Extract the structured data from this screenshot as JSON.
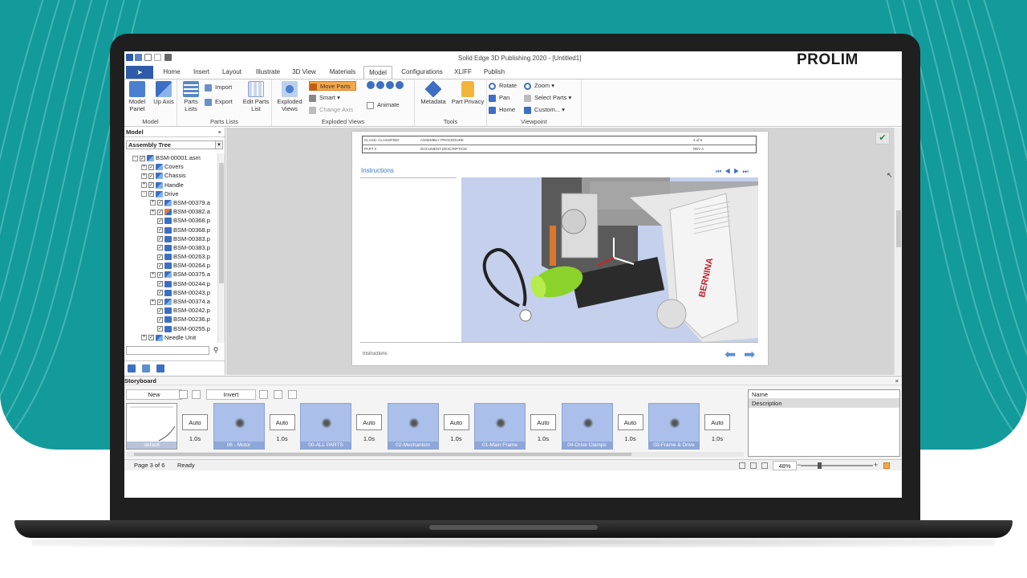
{
  "brand": "PROLIM",
  "app": {
    "title": "Solid Edge 3D Publishing  2020 - [Untitled1]"
  },
  "tabs": [
    "Home",
    "Insert",
    "Layout",
    "Illustrate",
    "3D View",
    "Materials",
    "Model",
    "Configurations",
    "XLIFF",
    "Publish"
  ],
  "ribbon": {
    "model": {
      "group": "Model",
      "model_panel": "Model Panel",
      "up_axis": "Up Axis"
    },
    "parts_lists": {
      "group": "Parts Lists",
      "parts_lists": "Parts Lists",
      "import": "Import",
      "export": "Export",
      "edit_parts_list": "Edit Parts List"
    },
    "exploded": {
      "group": "Exploded Views",
      "exploded_views": "Exploded Views",
      "move_parts": "Move Parts",
      "smart": "Smart",
      "change_axis": "Change Axis",
      "animate": "Animate"
    },
    "tools": {
      "group": "Tools",
      "metadata": "Metadata",
      "part_privacy": "Part Privacy"
    },
    "viewpoint": {
      "group": "Viewpoint",
      "rotate": "Rotate",
      "pan": "Pan",
      "home": "Home",
      "zoom": "Zoom",
      "select_parts": "Select Parts",
      "custom": "Custom..."
    }
  },
  "model_panel": {
    "title": "Model",
    "close": "×",
    "tree_mode": "Assembly Tree",
    "tree": [
      {
        "label": "BSM-00001.asm",
        "level": 0,
        "expand": "-",
        "type": "asm"
      },
      {
        "label": "Covers",
        "level": 1,
        "expand": "+",
        "type": "asm"
      },
      {
        "label": "Chassis",
        "level": 1,
        "expand": "+",
        "type": "asm"
      },
      {
        "label": "Handle",
        "level": 1,
        "expand": "+",
        "type": "asm"
      },
      {
        "label": "Drive",
        "level": 1,
        "expand": "-",
        "type": "asm"
      },
      {
        "label": "BSM-00379.a",
        "level": 2,
        "expand": "+",
        "type": "asm"
      },
      {
        "label": "BSM-00382.a",
        "level": 2,
        "expand": "+",
        "type": "hl"
      },
      {
        "label": "BSM-00368.p",
        "level": 2,
        "expand": "",
        "type": "part"
      },
      {
        "label": "BSM-00368.p",
        "level": 2,
        "expand": "",
        "type": "part"
      },
      {
        "label": "BSM-00383.p",
        "level": 2,
        "expand": "",
        "type": "part"
      },
      {
        "label": "BSM-00383.p",
        "level": 2,
        "expand": "",
        "type": "part"
      },
      {
        "label": "BSM-00263.p",
        "level": 2,
        "expand": "",
        "type": "part"
      },
      {
        "label": "BSM-00264.p",
        "level": 2,
        "expand": "",
        "type": "part"
      },
      {
        "label": "BSM-00375.a",
        "level": 2,
        "expand": "+",
        "type": "asm"
      },
      {
        "label": "BSM-00244.p",
        "level": 2,
        "expand": "",
        "type": "part"
      },
      {
        "label": "BSM-00243.p",
        "level": 2,
        "expand": "",
        "type": "part"
      },
      {
        "label": "BSM-00374.a",
        "level": 2,
        "expand": "+",
        "type": "asm"
      },
      {
        "label": "BSM-00242.p",
        "level": 2,
        "expand": "",
        "type": "part"
      },
      {
        "label": "BSM-00236.p",
        "level": 2,
        "expand": "",
        "type": "part"
      },
      {
        "label": "BSM-00255.p",
        "level": 2,
        "expand": "",
        "type": "part"
      },
      {
        "label": "Needle Unit",
        "level": 1,
        "expand": "+",
        "type": "asm"
      }
    ]
  },
  "document": {
    "header": {
      "class": "CLASS: CLASSIFIED",
      "procedure": "ASSEMBLY PROCEDURE",
      "page": "3 of 6",
      "part": "PART #",
      "doc_desc": "DOCUMENT DESCRIPTION",
      "rev": "REV A"
    },
    "section_title": "Instructions",
    "footer_label": "Instructions",
    "nav": {
      "first": "⏮",
      "prev": "◀",
      "play": "▶",
      "last": "⏭"
    },
    "product_label": "BERNINA"
  },
  "storyboard": {
    "title": "Storyboard",
    "new_label": "New",
    "invert_label": "Invert",
    "frames": [
      "default",
      "06 - Motor",
      "00-ALL PARTS",
      "02-Mechanism",
      "01-Main Frame",
      "04-Drive Clamps",
      "03-Frame & Drive"
    ],
    "transition_mode": "Auto",
    "transition_duration": "1.0s",
    "props": {
      "name": "Name",
      "description": "Description"
    }
  },
  "status": {
    "page": "Page 3 of 6",
    "ready": "Ready",
    "zoom": "48%",
    "zoom_level": 0.25
  },
  "colors": {
    "brand_teal": "#139a9b",
    "ribbon_accent": "#2e5aa8",
    "highlight_orange": "#f5a84a",
    "viewport_bg": "#c4d0ec"
  }
}
